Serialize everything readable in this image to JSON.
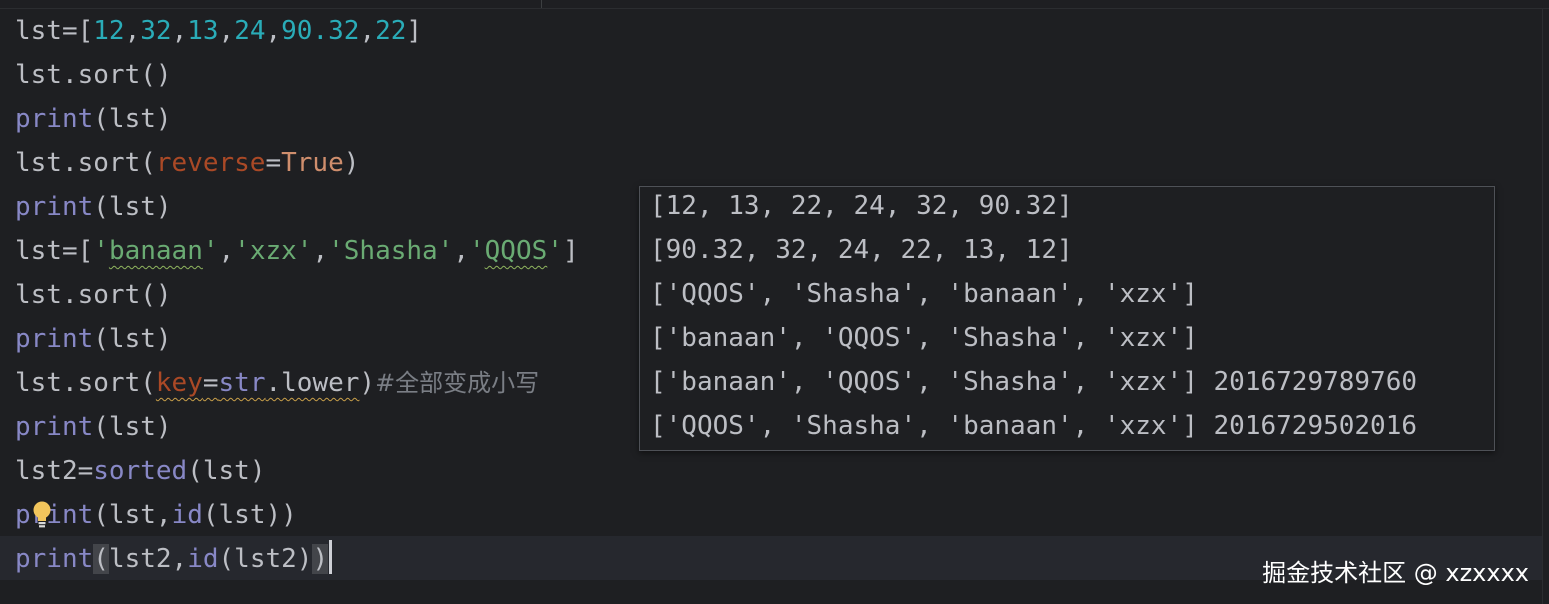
{
  "editor": {
    "lines": [
      {
        "segments": [
          [
            "plain",
            "lst=["
          ],
          [
            "num",
            "12"
          ],
          [
            "plain",
            ","
          ],
          [
            "num",
            "32"
          ],
          [
            "plain",
            ","
          ],
          [
            "num",
            "13"
          ],
          [
            "plain",
            ","
          ],
          [
            "num",
            "24"
          ],
          [
            "plain",
            ","
          ],
          [
            "num",
            "90.32"
          ],
          [
            "plain",
            ","
          ],
          [
            "num",
            "22"
          ],
          [
            "plain",
            "]"
          ]
        ]
      },
      {
        "segments": [
          [
            "plain",
            "lst.sort()"
          ]
        ]
      },
      {
        "segments": [
          [
            "kw",
            "print"
          ],
          [
            "plain",
            "(lst)"
          ]
        ]
      },
      {
        "segments": [
          [
            "plain",
            "lst.sort("
          ],
          [
            "param",
            "reverse"
          ],
          [
            "plain",
            "="
          ],
          [
            "const",
            "True"
          ],
          [
            "plain",
            ")"
          ]
        ]
      },
      {
        "segments": [
          [
            "kw",
            "print"
          ],
          [
            "plain",
            "(lst)"
          ]
        ]
      },
      {
        "segments": [
          [
            "plain",
            "lst=["
          ],
          [
            "str",
            "'"
          ],
          [
            "str squiggle",
            "banaan"
          ],
          [
            "str",
            "'"
          ],
          [
            "plain",
            ","
          ],
          [
            "str",
            "'xzx'"
          ],
          [
            "plain",
            ","
          ],
          [
            "str",
            "'Shasha'"
          ],
          [
            "plain",
            ","
          ],
          [
            "str",
            "'"
          ],
          [
            "str squiggle",
            "QQOS"
          ],
          [
            "str",
            "'"
          ],
          [
            "plain",
            "]"
          ]
        ]
      },
      {
        "segments": [
          [
            "plain",
            "lst.sort()"
          ]
        ]
      },
      {
        "segments": [
          [
            "kw",
            "print"
          ],
          [
            "plain",
            "(lst)"
          ]
        ]
      },
      {
        "segments": [
          [
            "plain",
            "lst.sort("
          ],
          [
            "param squiggle-warn",
            "key"
          ],
          [
            "plain squiggle-warn",
            "="
          ],
          [
            "fn squiggle-warn",
            "str"
          ],
          [
            "plain squiggle-warn",
            ".lower"
          ],
          [
            "plain",
            ")"
          ],
          [
            "cm",
            "#全部变成小写"
          ]
        ]
      },
      {
        "segments": [
          [
            "kw",
            "print"
          ],
          [
            "plain",
            "(lst)"
          ]
        ]
      },
      {
        "segments": [
          [
            "plain",
            "lst2="
          ],
          [
            "fn",
            "sorted"
          ],
          [
            "plain",
            "(lst)"
          ]
        ]
      },
      {
        "segments": [
          [
            "kw",
            "print"
          ],
          [
            "plain",
            "(lst,"
          ],
          [
            "fn",
            "id"
          ],
          [
            "plain",
            "(lst))"
          ]
        ]
      },
      {
        "segments": [
          [
            "kw",
            "print"
          ],
          [
            "plain brace-hl",
            "("
          ],
          [
            "plain",
            "lst2,"
          ],
          [
            "fn",
            "id"
          ],
          [
            "plain",
            "(lst2)"
          ],
          [
            "plain brace-hl",
            ")"
          ]
        ]
      }
    ]
  },
  "output": {
    "lines": [
      "[12, 13, 22, 24, 32, 90.32]",
      "[90.32, 32, 24, 22, 13, 12]",
      "['QQOS', 'Shasha', 'banaan', 'xzx']",
      "['banaan', 'QQOS', 'Shasha', 'xzx']",
      "['banaan', 'QQOS', 'Shasha', 'xzx'] 2016729789760",
      "['QQOS', 'Shasha', 'banaan', 'xzx'] 2016729502016"
    ]
  },
  "watermark": "掘金技术社区 @ xzxxxx",
  "icons": {
    "intention": "lightbulb-icon"
  },
  "colors": {
    "background": "#1e1f22",
    "keyword": "#8888c6",
    "number": "#2aacb8",
    "string": "#6aab73",
    "parameter": "#aa4926",
    "constant": "#cf8e6d",
    "comment": "#7a7e85",
    "text": "#bcbec4",
    "bulb": "#f2c55c"
  }
}
